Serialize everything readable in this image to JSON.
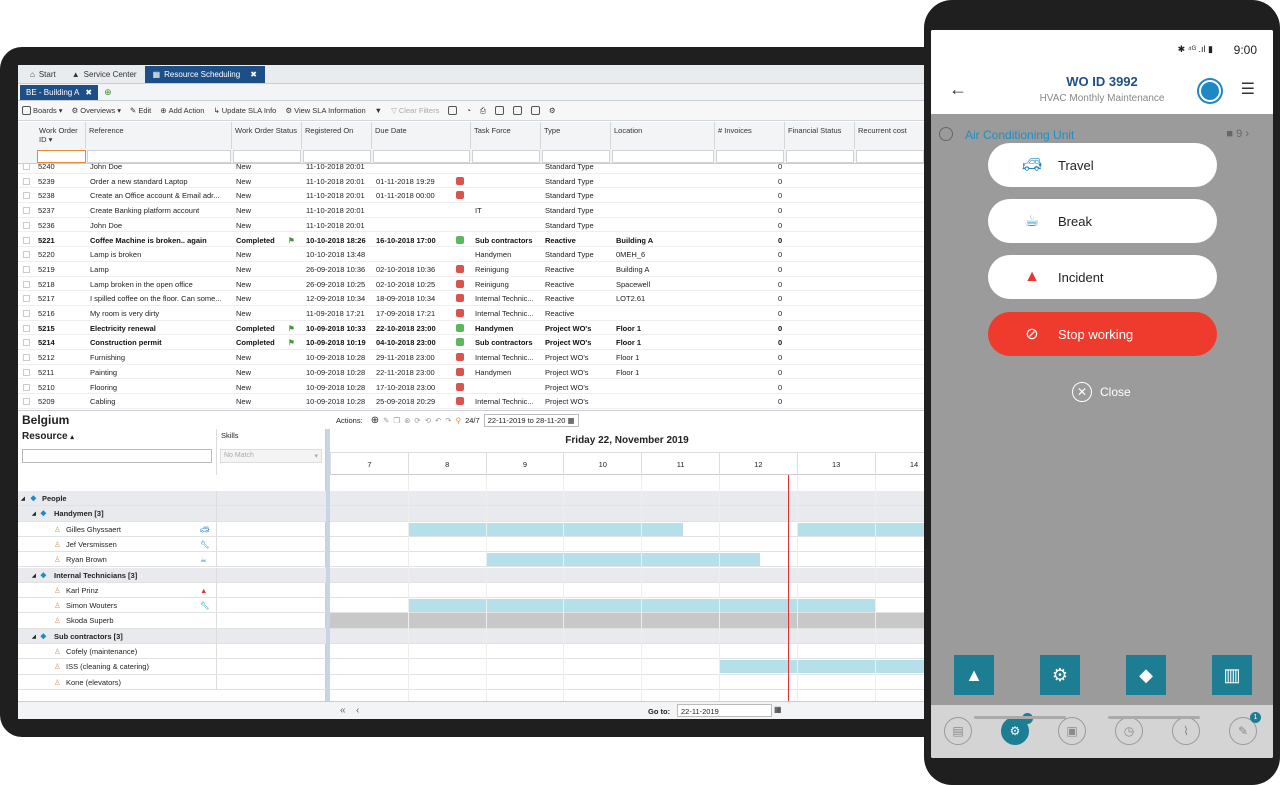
{
  "tablet": {
    "tabs": [
      {
        "label": "Start"
      },
      {
        "label": "Service Center"
      },
      {
        "label": "Resource Scheduling"
      }
    ],
    "subtab": "BE - Building A",
    "toolbar": [
      "Boards",
      "Overviews",
      "Edit",
      "Add Action",
      "Update SLA Info",
      "View SLA Information",
      "Clear Filters"
    ],
    "columns": [
      "Work Order ID",
      "Reference",
      "Work Order Status",
      "Registered On",
      "Due Date",
      "Task Force",
      "Type",
      "Location",
      "# Invoices",
      "Financial Status",
      "Recurrent cost"
    ],
    "rows": [
      {
        "id": "5240",
        "ref": "John Doe",
        "status": "New",
        "reg": "11-10-2018 20:01",
        "due": "",
        "tf": "",
        "type": "Standard Type",
        "loc": "",
        "inv": "0",
        "bold": false,
        "thumb": ""
      },
      {
        "id": "5239",
        "ref": "Order a new standard Laptop",
        "status": "New",
        "reg": "11-10-2018 20:01",
        "due": "01-11-2018 19:29",
        "tf": "",
        "type": "Standard Type",
        "loc": "",
        "inv": "0",
        "bold": false,
        "thumb": "down"
      },
      {
        "id": "5238",
        "ref": "Create an Office account & Email adr...",
        "status": "New",
        "reg": "11-10-2018 20:01",
        "due": "01-11-2018 00:00",
        "tf": "",
        "type": "Standard Type",
        "loc": "",
        "inv": "0",
        "bold": false,
        "thumb": "down"
      },
      {
        "id": "5237",
        "ref": "Create Banking platform account",
        "status": "New",
        "reg": "11-10-2018 20:01",
        "due": "",
        "tf": "IT",
        "type": "Standard Type",
        "loc": "",
        "inv": "0",
        "bold": false,
        "thumb": ""
      },
      {
        "id": "5236",
        "ref": "John Doe",
        "status": "New",
        "reg": "11-10-2018 20:01",
        "due": "",
        "tf": "",
        "type": "Standard Type",
        "loc": "",
        "inv": "0",
        "bold": false,
        "thumb": ""
      },
      {
        "id": "5221",
        "ref": "Coffee Machine is broken.. again",
        "status": "Completed",
        "reg": "10-10-2018 18:26",
        "due": "16-10-2018 17:00",
        "tf": "Sub contractors",
        "type": "Reactive",
        "loc": "Building A",
        "inv": "0",
        "bold": true,
        "thumb": "up"
      },
      {
        "id": "5220",
        "ref": "Lamp is broken",
        "status": "New",
        "reg": "10-10-2018 13:48",
        "due": "",
        "tf": "Handymen",
        "type": "Standard Type",
        "loc": "0MEH_6",
        "inv": "0",
        "bold": false,
        "thumb": ""
      },
      {
        "id": "5219",
        "ref": "Lamp",
        "status": "New",
        "reg": "26-09-2018 10:36",
        "due": "02-10-2018 10:36",
        "tf": "Reinigung",
        "type": "Reactive",
        "loc": "Building A",
        "inv": "0",
        "bold": false,
        "thumb": "down"
      },
      {
        "id": "5218",
        "ref": "Lamp broken in the open office",
        "status": "New",
        "reg": "26-09-2018 10:25",
        "due": "02-10-2018 10:25",
        "tf": "Reinigung",
        "type": "Reactive",
        "loc": "Spacewell",
        "inv": "0",
        "bold": false,
        "thumb": "down"
      },
      {
        "id": "5217",
        "ref": "I spilled coffee on the floor. Can some...",
        "status": "New",
        "reg": "12-09-2018 10:34",
        "due": "18-09-2018 10:34",
        "tf": "Internal Technic...",
        "type": "Reactive",
        "loc": "LOT2.61",
        "inv": "0",
        "bold": false,
        "thumb": "down"
      },
      {
        "id": "5216",
        "ref": "My room is very dirty",
        "status": "New",
        "reg": "11-09-2018 17:21",
        "due": "17-09-2018 17:21",
        "tf": "Internal Technic...",
        "type": "Reactive",
        "loc": "",
        "inv": "0",
        "bold": false,
        "thumb": "down"
      },
      {
        "id": "5215",
        "ref": "Electricity renewal",
        "status": "Completed",
        "reg": "10-09-2018 10:33",
        "due": "22-10-2018 23:00",
        "tf": "Handymen",
        "type": "Project WO's",
        "loc": "Floor 1",
        "inv": "0",
        "bold": true,
        "thumb": "up"
      },
      {
        "id": "5214",
        "ref": "Construction permit",
        "status": "Completed",
        "reg": "10-09-2018 10:19",
        "due": "04-10-2018 23:00",
        "tf": "Sub contractors",
        "type": "Project WO's",
        "loc": "Floor 1",
        "inv": "0",
        "bold": true,
        "thumb": "up"
      },
      {
        "id": "5212",
        "ref": "Furnishing",
        "status": "New",
        "reg": "10-09-2018 10:28",
        "due": "29-11-2018 23:00",
        "tf": "Internal Technic...",
        "type": "Project WO's",
        "loc": "Floor 1",
        "inv": "0",
        "bold": false,
        "thumb": "down"
      },
      {
        "id": "5211",
        "ref": "Painting",
        "status": "New",
        "reg": "10-09-2018 10:28",
        "due": "22-11-2018 23:00",
        "tf": "Handymen",
        "type": "Project WO's",
        "loc": "Floor 1",
        "inv": "0",
        "bold": false,
        "thumb": "down"
      },
      {
        "id": "5210",
        "ref": "Flooring",
        "status": "New",
        "reg": "10-09-2018 10:28",
        "due": "17-10-2018 23:00",
        "tf": "",
        "type": "Project WO's",
        "loc": "",
        "inv": "0",
        "bold": false,
        "thumb": "down"
      },
      {
        "id": "5209",
        "ref": "Cabling",
        "status": "New",
        "reg": "10-09-2018 10:28",
        "due": "25-09-2018 20:29",
        "tf": "Internal Technic...",
        "type": "Project WO's",
        "loc": "",
        "inv": "0",
        "bold": false,
        "thumb": "down"
      }
    ],
    "schedule": {
      "title": "Belgium",
      "actions_label": "Actions:",
      "mode": "24/7",
      "range": "22-11-2019 to 28-11-20",
      "resource_label": "Resource",
      "skills_label": "Skills",
      "skills_placeholder": "No Match",
      "day_title": "Friday 22, November 2019",
      "hours": [
        "7",
        "8",
        "9",
        "10",
        "11",
        "12",
        "13",
        "14"
      ],
      "goto_label": "Go to:",
      "goto_value": "22-11-2019",
      "resources": [
        {
          "label": "People",
          "level": 0,
          "group": true,
          "icon": ""
        },
        {
          "label": "Handymen [3]",
          "level": 1,
          "group": true,
          "icon": ""
        },
        {
          "label": "Gilles Ghyssaert",
          "level": 2,
          "group": false,
          "icon": "car-icon"
        },
        {
          "label": "Jef Versmissen",
          "level": 2,
          "group": false,
          "icon": "wrench-icon"
        },
        {
          "label": "Ryan Brown",
          "level": 2,
          "group": false,
          "icon": "cup-icon"
        },
        {
          "label": "Internal Technicians [3]",
          "level": 1,
          "group": true,
          "icon": ""
        },
        {
          "label": "Karl Prinz",
          "level": 2,
          "group": false,
          "icon": "warning-icon"
        },
        {
          "label": "Simon Wouters",
          "level": 2,
          "group": false,
          "icon": "wrench-icon"
        },
        {
          "label": "Skoda Superb",
          "level": 2,
          "group": false,
          "icon": ""
        },
        {
          "label": "Sub contractors [3]",
          "level": 1,
          "group": true,
          "icon": ""
        },
        {
          "label": "Cofely (maintenance)",
          "level": 2,
          "group": false,
          "icon": ""
        },
        {
          "label": "ISS (cleaning & catering)",
          "level": 2,
          "group": false,
          "icon": ""
        },
        {
          "label": "Kone (elevators)",
          "level": 2,
          "group": false,
          "icon": ""
        }
      ]
    }
  },
  "phone": {
    "time": "9:00",
    "title": "WO ID 3992",
    "subtitle": "HVAC Monthly Maintenance",
    "asset": "Air Conditioning Unit",
    "asset_count": "9",
    "buttons": [
      {
        "label": "Travel",
        "icon": "car-icon"
      },
      {
        "label": "Break",
        "icon": "cup-icon"
      },
      {
        "label": "Incident",
        "icon": "warning-icon"
      },
      {
        "label": "Stop working",
        "icon": "stop-icon"
      }
    ],
    "close_label": "Close",
    "badge": "1"
  }
}
